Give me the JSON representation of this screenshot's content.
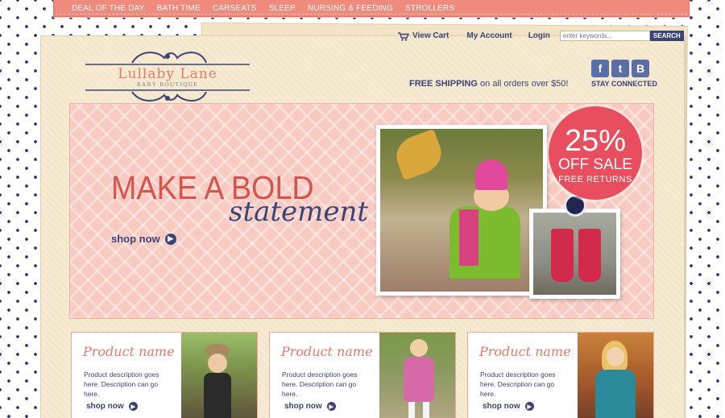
{
  "nav": {
    "items": [
      "DEAL OF THE DAY",
      "BATH TIME",
      "CARSEATS",
      "SLEEP",
      "NURSING & FEEDING",
      "STROLLERS"
    ]
  },
  "header": {
    "view_cart": "View Cart",
    "my_account": "My Account",
    "login": "Login",
    "search_placeholder": "enter keywords...",
    "search_button": "SEARCH",
    "logo_title": "Lullaby Lane",
    "logo_subtitle": "BABY BOUTIQUE",
    "shipping_bold": "FREE SHIPPING",
    "shipping_rest": " on all orders over $50!",
    "stay_connected": "STAY CONNECTED",
    "social": [
      {
        "icon": "facebook-icon",
        "glyph": "f"
      },
      {
        "icon": "twitter-icon",
        "glyph": "t"
      },
      {
        "icon": "blogger-icon",
        "glyph": "B"
      }
    ]
  },
  "hero": {
    "headline": "MAKE A BOLD",
    "script": "statement",
    "shop_now": "shop now",
    "sale_percent": "25%",
    "sale_off": "OFF SALE",
    "sale_free": "FREE RETURNS"
  },
  "products": [
    {
      "name": "Product name",
      "description": "Product description goes here. Description can go here.",
      "shop_now": "shop now"
    },
    {
      "name": "Product name",
      "description": "Product description goes here. Description can go here.",
      "shop_now": "shop now"
    },
    {
      "name": "Product name",
      "description": "Product description goes here. Description can go here.",
      "shop_now": "shop now"
    }
  ],
  "colors": {
    "nav_bg": "#ef8a7d",
    "navy": "#3b4477",
    "coral": "#e27b6f",
    "sale_red": "#e94e5e",
    "hero_pink": "#f7cbc2",
    "paper": "#f6ead1"
  }
}
